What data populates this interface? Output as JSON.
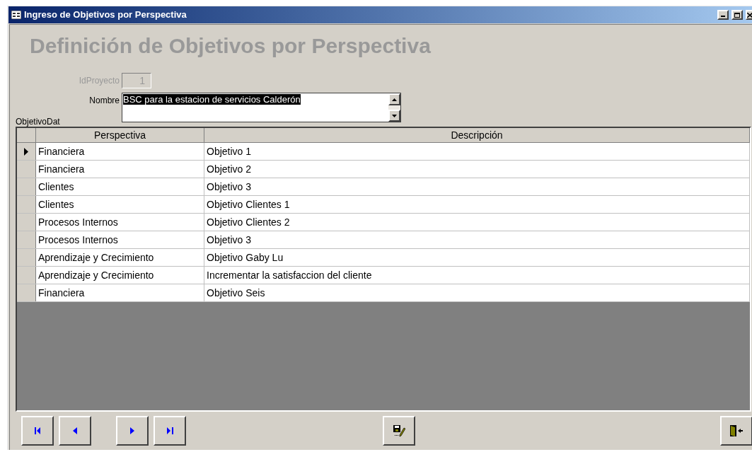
{
  "window": {
    "title": "Ingreso de Objetivos por Perspectiva"
  },
  "heading": "Definición de Objetivos por Perspectiva",
  "id_field": {
    "label": "IdProyecto",
    "value": "1",
    "disabled": true
  },
  "name_field": {
    "label": "Nombre",
    "value": "BSC para la estacion de servicios Calderón",
    "text_selected": true
  },
  "subform_label": "ObjetivoDat",
  "table": {
    "columns": [
      "Perspectiva",
      "Descripción"
    ],
    "rows": [
      {
        "cells": [
          "Financiera",
          "Objetivo 1"
        ],
        "selected": true
      },
      {
        "cells": [
          "Financiera",
          "Objetivo 2"
        ],
        "selected": false
      },
      {
        "cells": [
          "Clientes",
          "Objetivo 3"
        ],
        "selected": false
      },
      {
        "cells": [
          "Clientes",
          "Objetivo Clientes 1"
        ],
        "selected": false
      },
      {
        "cells": [
          "Procesos Internos",
          "Objetivo Clientes 2"
        ],
        "selected": false
      },
      {
        "cells": [
          "Procesos Internos",
          "Objetivo 3"
        ],
        "selected": false
      },
      {
        "cells": [
          "Aprendizaje y Crecimiento",
          "Objetivo Gaby Lu"
        ],
        "selected": false
      },
      {
        "cells": [
          "Aprendizaje y Crecimiento",
          "Incrementar la satisfaccion del cliente"
        ],
        "selected": false
      },
      {
        "cells": [
          "Financiera",
          "Objetivo Seis"
        ],
        "selected": false
      }
    ]
  },
  "buttons": [
    {
      "kind": "first"
    },
    {
      "kind": "prev"
    },
    {
      "kind": "next"
    },
    {
      "kind": "last"
    },
    {
      "kind": "save"
    },
    {
      "kind": "exit"
    }
  ]
}
